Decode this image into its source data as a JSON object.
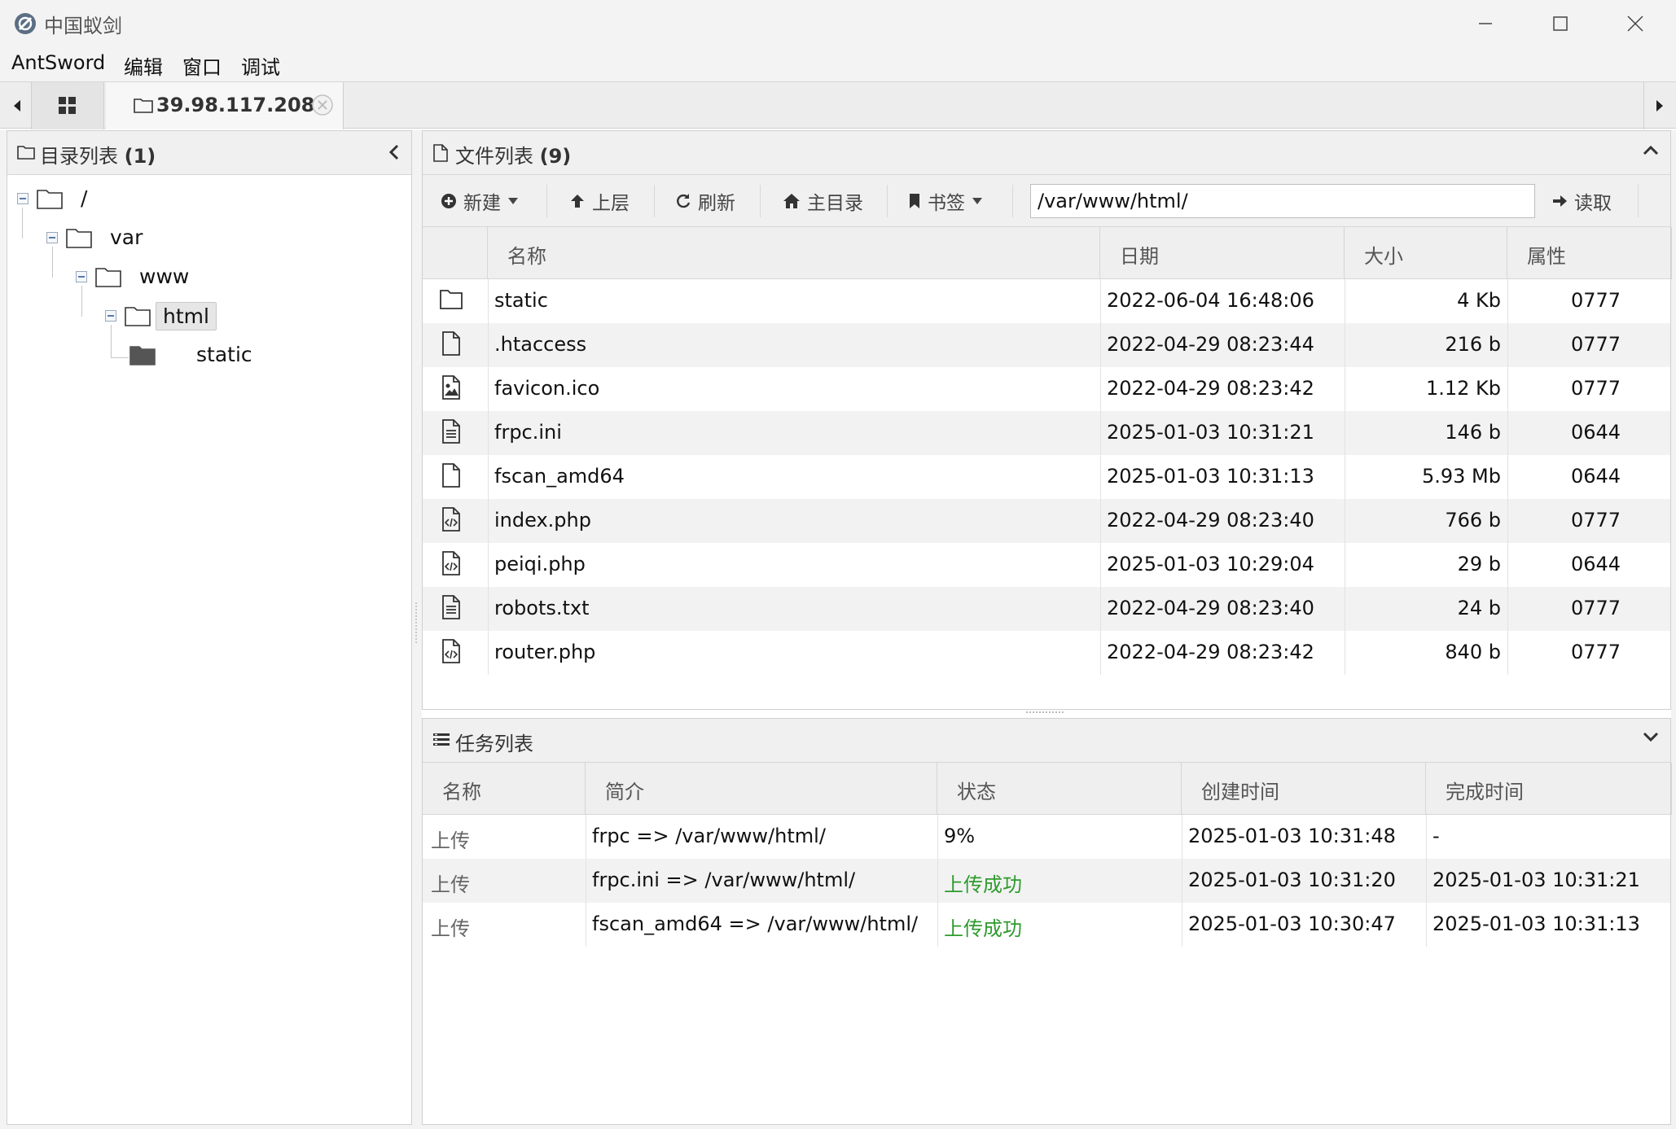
{
  "window": {
    "title": "中国蚁剑"
  },
  "menu": [
    "AntSword",
    "编辑",
    "窗口",
    "调试"
  ],
  "tabs": {
    "active_label": "39.98.117.208"
  },
  "dir_panel": {
    "title": "目录列表",
    "count": "(1)",
    "tree": [
      {
        "label": "/",
        "depth": 0
      },
      {
        "label": "var",
        "depth": 1
      },
      {
        "label": "www",
        "depth": 2
      },
      {
        "label": "html",
        "depth": 3,
        "selected": true
      },
      {
        "label": "static",
        "depth": 4
      }
    ]
  },
  "file_panel": {
    "title": "文件列表",
    "count": "(9)",
    "toolbar": {
      "new_label": "新建",
      "up_label": "上层",
      "refresh_label": "刷新",
      "home_label": "主目录",
      "bookmark_label": "书签",
      "path_value": "/var/www/html/",
      "read_label": "读取"
    },
    "columns": [
      "名称",
      "日期",
      "大小",
      "属性"
    ],
    "rows": [
      {
        "icon": "folder-icon",
        "name": "static",
        "date": "2022-06-04 16:48:06",
        "size": "4 Kb",
        "perm": "0777"
      },
      {
        "icon": "file-icon",
        "name": ".htaccess",
        "date": "2022-04-29 08:23:44",
        "size": "216 b",
        "perm": "0777"
      },
      {
        "icon": "image-file-icon",
        "name": "favicon.ico",
        "date": "2022-04-29 08:23:42",
        "size": "1.12 Kb",
        "perm": "0777"
      },
      {
        "icon": "text-file-icon",
        "name": "frpc.ini",
        "date": "2025-01-03 10:31:21",
        "size": "146 b",
        "perm": "0644"
      },
      {
        "icon": "file-icon",
        "name": "fscan_amd64",
        "date": "2025-01-03 10:31:13",
        "size": "5.93 Mb",
        "perm": "0644"
      },
      {
        "icon": "code-file-icon",
        "name": "index.php",
        "date": "2022-04-29 08:23:40",
        "size": "766 b",
        "perm": "0777"
      },
      {
        "icon": "code-file-icon",
        "name": "peiqi.php",
        "date": "2025-01-03 10:29:04",
        "size": "29 b",
        "perm": "0644"
      },
      {
        "icon": "text-file-icon",
        "name": "robots.txt",
        "date": "2022-04-29 08:23:40",
        "size": "24 b",
        "perm": "0777"
      },
      {
        "icon": "code-file-icon",
        "name": "router.php",
        "date": "2022-04-29 08:23:42",
        "size": "840 b",
        "perm": "0777"
      }
    ]
  },
  "task_panel": {
    "title": "任务列表",
    "columns": [
      "名称",
      "简介",
      "状态",
      "创建时间",
      "完成时间"
    ],
    "rows": [
      {
        "kind": "上传",
        "desc": "frpc => /var/www/html/",
        "status": "9%",
        "success": false,
        "created": "2025-01-03 10:31:48",
        "done": "-"
      },
      {
        "kind": "上传",
        "desc": "frpc.ini => /var/www/html/",
        "status": "上传成功",
        "success": true,
        "created": "2025-01-03 10:31:20",
        "done": "2025-01-03 10:31:21"
      },
      {
        "kind": "上传",
        "desc": "fscan_amd64 => /var/www/html/",
        "status": "上传成功",
        "success": true,
        "created": "2025-01-03 10:30:47",
        "done": "2025-01-03 10:31:13"
      }
    ]
  },
  "colors": {
    "success": "#2e9b2e",
    "selected_bg": "#e6e6e6"
  }
}
